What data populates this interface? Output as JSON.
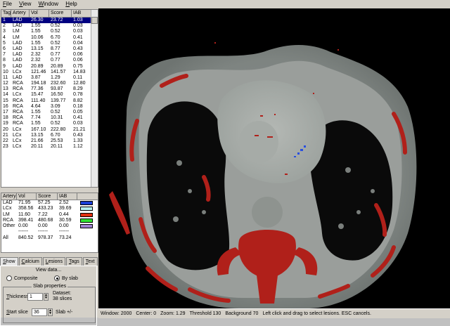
{
  "menu": {
    "file": "File",
    "view": "View",
    "window": "Window",
    "help": "Help"
  },
  "lesion_table": {
    "headers": [
      "Tag",
      "Artery",
      "Vol",
      "Score",
      "IAB"
    ],
    "rows": [
      [
        "1",
        "LAD",
        "26.30",
        "23.72",
        "1.03"
      ],
      [
        "2",
        "LAD",
        "1.55",
        "0.52",
        "0.03"
      ],
      [
        "3",
        "LM",
        "1.55",
        "0.52",
        "0.03"
      ],
      [
        "4",
        "LM",
        "10.06",
        "6.70",
        "0.41"
      ],
      [
        "5",
        "LAD",
        "1.55",
        "0.52",
        "0.04"
      ],
      [
        "6",
        "LAD",
        "13.15",
        "8.77",
        "0.43"
      ],
      [
        "7",
        "LAD",
        "2.32",
        "0.77",
        "0.06"
      ],
      [
        "8",
        "LAD",
        "2.32",
        "0.77",
        "0.06"
      ],
      [
        "9",
        "LAD",
        "20.89",
        "20.89",
        "0.75"
      ],
      [
        "10",
        "LCx",
        "121.46",
        "141.57",
        "14.83"
      ],
      [
        "11",
        "LAD",
        "3.87",
        "1.29",
        "0.11"
      ],
      [
        "12",
        "RCA",
        "194.18",
        "232.60",
        "12.80"
      ],
      [
        "13",
        "RCA",
        "77.36",
        "93.87",
        "8.29"
      ],
      [
        "14",
        "LCx",
        "15.47",
        "16.50",
        "0.78"
      ],
      [
        "15",
        "RCA",
        "111.40",
        "139.77",
        "8.82"
      ],
      [
        "16",
        "RCA",
        "4.64",
        "3.09",
        "0.18"
      ],
      [
        "17",
        "RCA",
        "1.55",
        "0.52",
        "0.05"
      ],
      [
        "18",
        "RCA",
        "7.74",
        "10.31",
        "0.41"
      ],
      [
        "19",
        "RCA",
        "1.55",
        "0.52",
        "0.03"
      ],
      [
        "20",
        "LCx",
        "167.10",
        "222.80",
        "21.21"
      ],
      [
        "21",
        "LCx",
        "13.15",
        "6.70",
        "0.43"
      ],
      [
        "22",
        "LCx",
        "21.66",
        "25.53",
        "1.33"
      ],
      [
        "23",
        "LCx",
        "20.11",
        "20.11",
        "1.12"
      ]
    ]
  },
  "summary": {
    "headers": [
      "Artery",
      "Vol",
      "Score",
      "IAB"
    ],
    "rows": [
      {
        "artery": "LAD",
        "vol": "71.95",
        "score": "57.25",
        "iab": "2.52",
        "color": "#1a3fd6"
      },
      {
        "artery": "LCx",
        "vol": "358.56",
        "score": "433.23",
        "iab": "39.69",
        "color": "#b8f0f0"
      },
      {
        "artery": "LM",
        "vol": "11.60",
        "score": "7.22",
        "iab": "0.44",
        "color": "#e03010"
      },
      {
        "artery": "RCA",
        "vol": "398.41",
        "score": "480.68",
        "iab": "30.59",
        "color": "#30e030"
      },
      {
        "artery": "Other",
        "vol": "0.00",
        "score": "0.00",
        "iab": "0.00",
        "color": "#a080d0"
      }
    ],
    "dashes": [
      "------",
      "------",
      "------"
    ],
    "total": {
      "label": "All",
      "vol": "840.52",
      "score": "978.37",
      "iab": "73.24"
    }
  },
  "tabs": [
    "Show",
    "Calcium",
    "Lesions",
    "Tags",
    "Text"
  ],
  "panel": {
    "view_data": "View data...",
    "composite": "Composite",
    "by_slab": "By slab",
    "slab_properties": "Slab properties",
    "thickness_label": "Thickness",
    "thickness_value": "1",
    "dataset_label": "Dataset:",
    "dataset_value": "38 slices",
    "start_label": "Start slice",
    "start_value": "36",
    "slab_pm": "Slab +/-"
  },
  "status": {
    "window": "Window: 2000",
    "center": "Center: 0",
    "zoom": "Zoom: 1.29",
    "threshold": "Threshold 130",
    "background": "Background 70",
    "hint": "Left click and drag to select lesions. ESC cancels."
  },
  "colors": {
    "calcium_overlay": "#b0201a",
    "lad_highlight": "#2a4fe0",
    "selection": "#000080"
  }
}
